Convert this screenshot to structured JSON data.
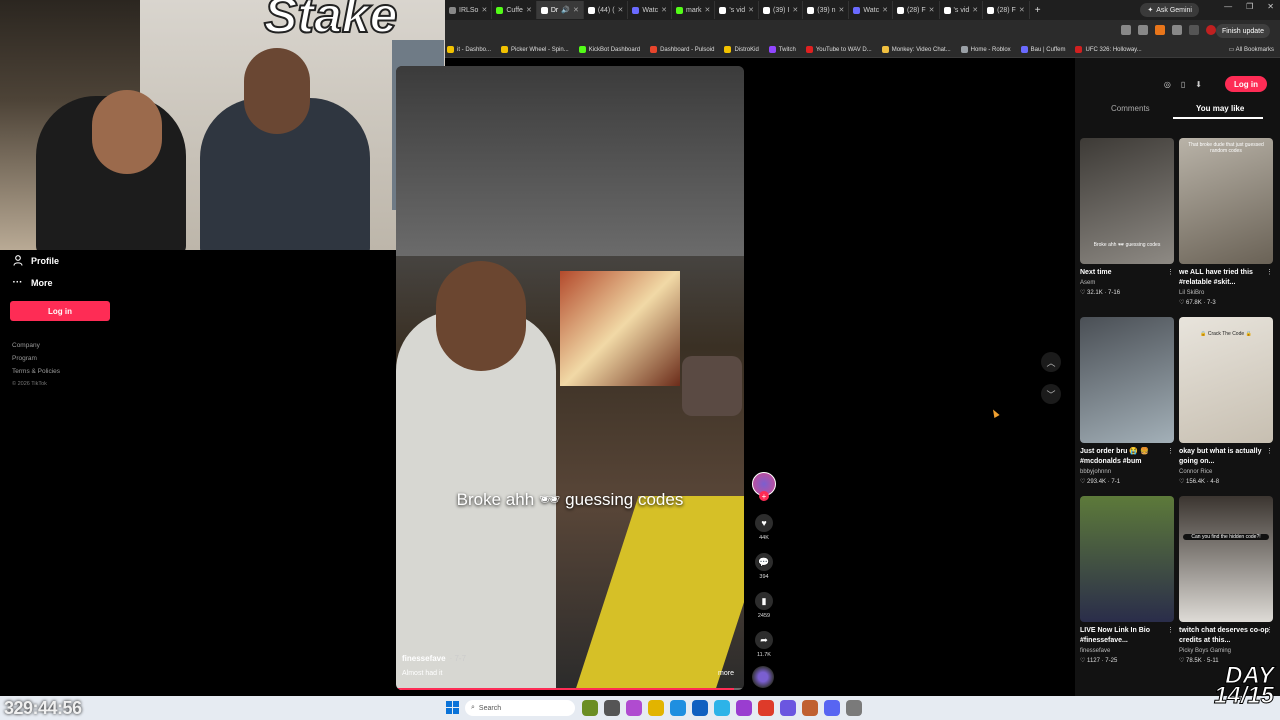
{
  "browser": {
    "tabs": [
      {
        "label": "IRLSo",
        "active": false
      },
      {
        "label": "Cuffe",
        "active": false
      },
      {
        "label": "Dr",
        "active": true
      },
      {
        "label": "(44) (",
        "active": false
      },
      {
        "label": "Watc",
        "active": false
      },
      {
        "label": "mark",
        "active": false
      },
      {
        "label": "'s vid",
        "active": false
      },
      {
        "label": "(39) I",
        "active": false
      },
      {
        "label": "(39) n",
        "active": false
      },
      {
        "label": "Watc",
        "active": false
      },
      {
        "label": "(28) F",
        "active": false
      },
      {
        "label": "'s vid",
        "active": false
      },
      {
        "label": "(28) F",
        "active": false
      }
    ],
    "new_tab": "+",
    "ask_gemini": "Ask Gemini",
    "finish_update": "Finish update",
    "bookmarks": [
      {
        "label": "it - Dashbo...",
        "color": "#f2c200"
      },
      {
        "label": "Picker Wheel - Spin...",
        "color": "#f2c200"
      },
      {
        "label": "KickBot Dashboard",
        "color": "#53fc18"
      },
      {
        "label": "Dashboard - Pulsoid",
        "color": "#e8452c"
      },
      {
        "label": "DistroKid",
        "color": "#f2c200"
      },
      {
        "label": "Twitch",
        "color": "#9146ff"
      },
      {
        "label": "YouTube to WAV D...",
        "color": "#e02020"
      },
      {
        "label": "Monkey: Video Chat...",
        "color": "#f0c040"
      },
      {
        "label": "Home - Roblox",
        "color": "#9aa0a6"
      },
      {
        "label": "Bau | Cuffem",
        "color": "#6a6aff"
      },
      {
        "label": "UFC 326: Holloway...",
        "color": "#d02020"
      }
    ],
    "all_bookmarks": "All Bookmarks"
  },
  "webcam": {
    "sign": "Stake"
  },
  "sidebar": {
    "profile": "Profile",
    "more": "More",
    "login": "Log in",
    "footer": [
      "Company",
      "Program",
      "Terms & Policies"
    ],
    "copyright": "© 2026 TikTok"
  },
  "video": {
    "caption": "Broke ahh 🕶 guessing codes",
    "author": "finessefave",
    "date": "· 7-7",
    "description": "Almost had it",
    "more": "more",
    "progress": 0.97
  },
  "actions": {
    "likes": "44K",
    "comments": "394",
    "saves": "2459",
    "shares": "11.7K"
  },
  "panel": {
    "login": "Log in",
    "tab_comments": "Comments",
    "tab_you_may_like": "You may like",
    "cards": [
      {
        "title": "Next time",
        "author": "Asem",
        "stats": "♡ 32.1K · 7-16",
        "thumb_text": "Broke ahh 🕶 guessing codes",
        "colors": [
          "#3d3a36",
          "#8e8a84"
        ]
      },
      {
        "title": "we ALL have tried this #relatable #skit...",
        "author": "Lil SkiBro",
        "stats": "♡ 67.8K · 7-3",
        "thumb_text": "That broke dude that just guessed random codes",
        "colors": [
          "#b9b3a8",
          "#6a6256"
        ]
      },
      {
        "title": "Just order bru 😭 🍔 #mcdonalds #bum",
        "author": "bbbyjohnnn",
        "stats": "♡ 293.4K · 7-1",
        "thumb_text": "",
        "colors": [
          "#4a4f55",
          "#a3b0b8"
        ]
      },
      {
        "title": "okay but what is actually going on...",
        "author": "Connor Rice",
        "stats": "♡ 156.4K · 4-8",
        "thumb_text": "🔒 Crack The Code 🔒",
        "colors": [
          "#e8e4dc",
          "#c7bfb1"
        ]
      },
      {
        "title": "LIVE Now Link In Bio #finessefave...",
        "author": "finessefave",
        "stats": "♡ 1127 · 7-25",
        "thumb_text": "",
        "colors": [
          "#5d7a3a",
          "#2a2d4a"
        ]
      },
      {
        "title": "twitch chat deserves co-op credits at this...",
        "author": "Picky Boys Gaming",
        "stats": "♡ 78.5K · 5-11",
        "thumb_text": "Can you find the hidden code?!",
        "colors": [
          "#3b3530",
          "#dedbd6"
        ]
      }
    ]
  },
  "taskbar": {
    "search": "Search"
  },
  "overlays": {
    "clock": "329:44:56",
    "day_label": "DAY",
    "day_count": "14/15"
  }
}
